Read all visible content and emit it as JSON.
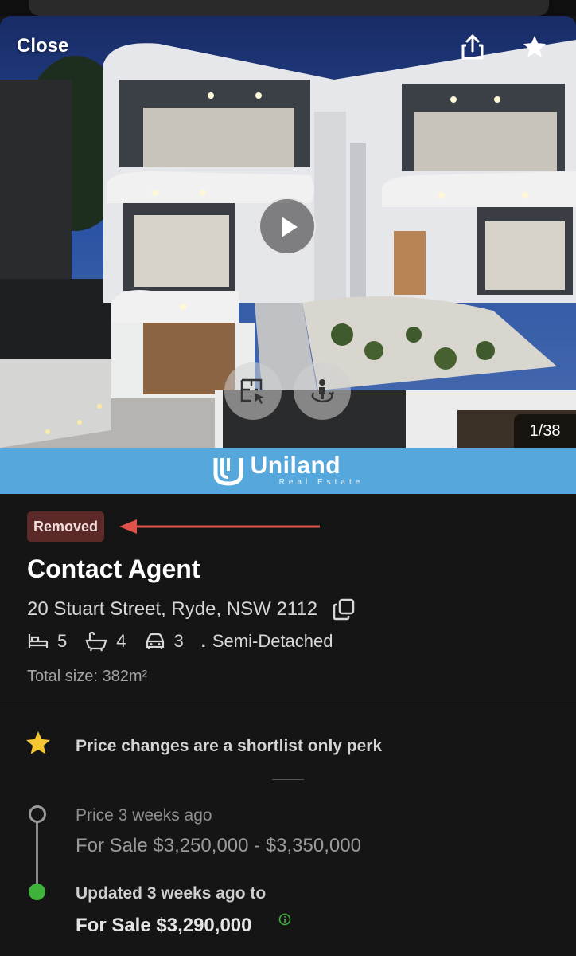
{
  "header": {
    "close_label": "Close",
    "share_icon": "share-icon",
    "favorite_icon": "star-icon"
  },
  "gallery": {
    "counter": "1/38",
    "play_icon": "play-icon",
    "floorplan_icon": "floorplan-icon",
    "tour_icon": "virtual-tour-icon"
  },
  "agency": {
    "name": "Uniland",
    "tagline": "Real Estate",
    "color": "#55a7dc"
  },
  "listing": {
    "status_badge": "Removed",
    "price": "Contact Agent",
    "address": "20 Stuart Street, Ryde, NSW 2112",
    "bedrooms": "5",
    "bathrooms": "4",
    "parking": "3",
    "separator": ".",
    "property_type": "Semi-Detached",
    "total_size": "Total size: 382m²"
  },
  "price_history": {
    "perk_text": "Price changes are a shortlist only perk",
    "entries": [
      {
        "label": "Price 3 weeks ago",
        "value": "For Sale $3,250,000 - $3,350,000"
      },
      {
        "label": "Updated 3 weeks ago to",
        "value": "For Sale $3,290,000"
      }
    ]
  },
  "colors": {
    "badge_bg": "#5a2928",
    "arrow": "#e0524a",
    "timeline_current": "#3eb23a",
    "star": "#f5c633"
  }
}
